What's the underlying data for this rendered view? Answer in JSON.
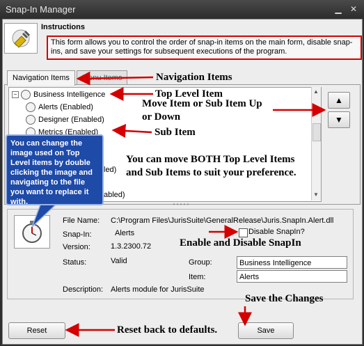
{
  "window": {
    "title": "Snap-In Manager",
    "controls": [
      "minimize",
      "close"
    ]
  },
  "header": {
    "icon": "snapin-plug-icon",
    "instructions_title": "Instructions",
    "instructions_text": "This form allows you to control the order of snap-in items on the main form, disable snap-ins, and save your settings for subsequent executions of the program."
  },
  "tabs": [
    {
      "label": "Navigation Items",
      "selected": true
    },
    {
      "label": "Menu Items",
      "selected": false
    }
  ],
  "tree": {
    "top_level": {
      "label": "Business Intelligence",
      "expander": "−"
    },
    "children": [
      {
        "label": "Alerts (Enabled)"
      },
      {
        "label": "Designer (Enabled)"
      },
      {
        "label": "Metrics (Enabled)"
      }
    ],
    "partial_rows": [
      "led)",
      "abled)"
    ]
  },
  "move_buttons": {
    "up_icon": "arrow-up-icon",
    "down_icon": "arrow-down-icon"
  },
  "details": {
    "file_name_label": "File Name:",
    "file_name_value": "C:\\Program Files\\JurisSuite\\GeneralRelease\\Juris.SnapIn.Alert.dll",
    "snapin_label": "Snap-In:",
    "snapin_value": "Alerts",
    "version_label": "Version:",
    "version_value": "1.3.2300.72",
    "status_label": "Status:",
    "status_value": "Valid",
    "description_label": "Description:",
    "description_value": "Alerts module for JurisSuite",
    "disable_label": "Disable SnapIn?",
    "disable_checked": false,
    "group_label": "Group:",
    "group_value": "Business Intelligence",
    "item_label": "Item:",
    "item_value": "Alerts"
  },
  "buttons": {
    "reset": "Reset",
    "save": "Save"
  },
  "annotations": {
    "navigation_items": "Navigation Items",
    "top_level_item": "Top Level Item",
    "move_item_line1": "Move Item or Sub Item Up",
    "move_item_line2": "or Down",
    "sub_item": "Sub Item",
    "move_both_line1": "You can move BOTH Top Level Items",
    "move_both_line2": "and Sub Items to suit your preference.",
    "callout": "You can change the image used on Top Level items by double clicking the image and navigating to the file you want to replace it with.",
    "enable_disable": "Enable and Disable SnapIn",
    "save_changes": "Save the Changes",
    "reset_defaults": "Reset back to defaults."
  },
  "colors": {
    "annotation_red": "#d40000",
    "callout_blue": "#1e4aa8"
  }
}
